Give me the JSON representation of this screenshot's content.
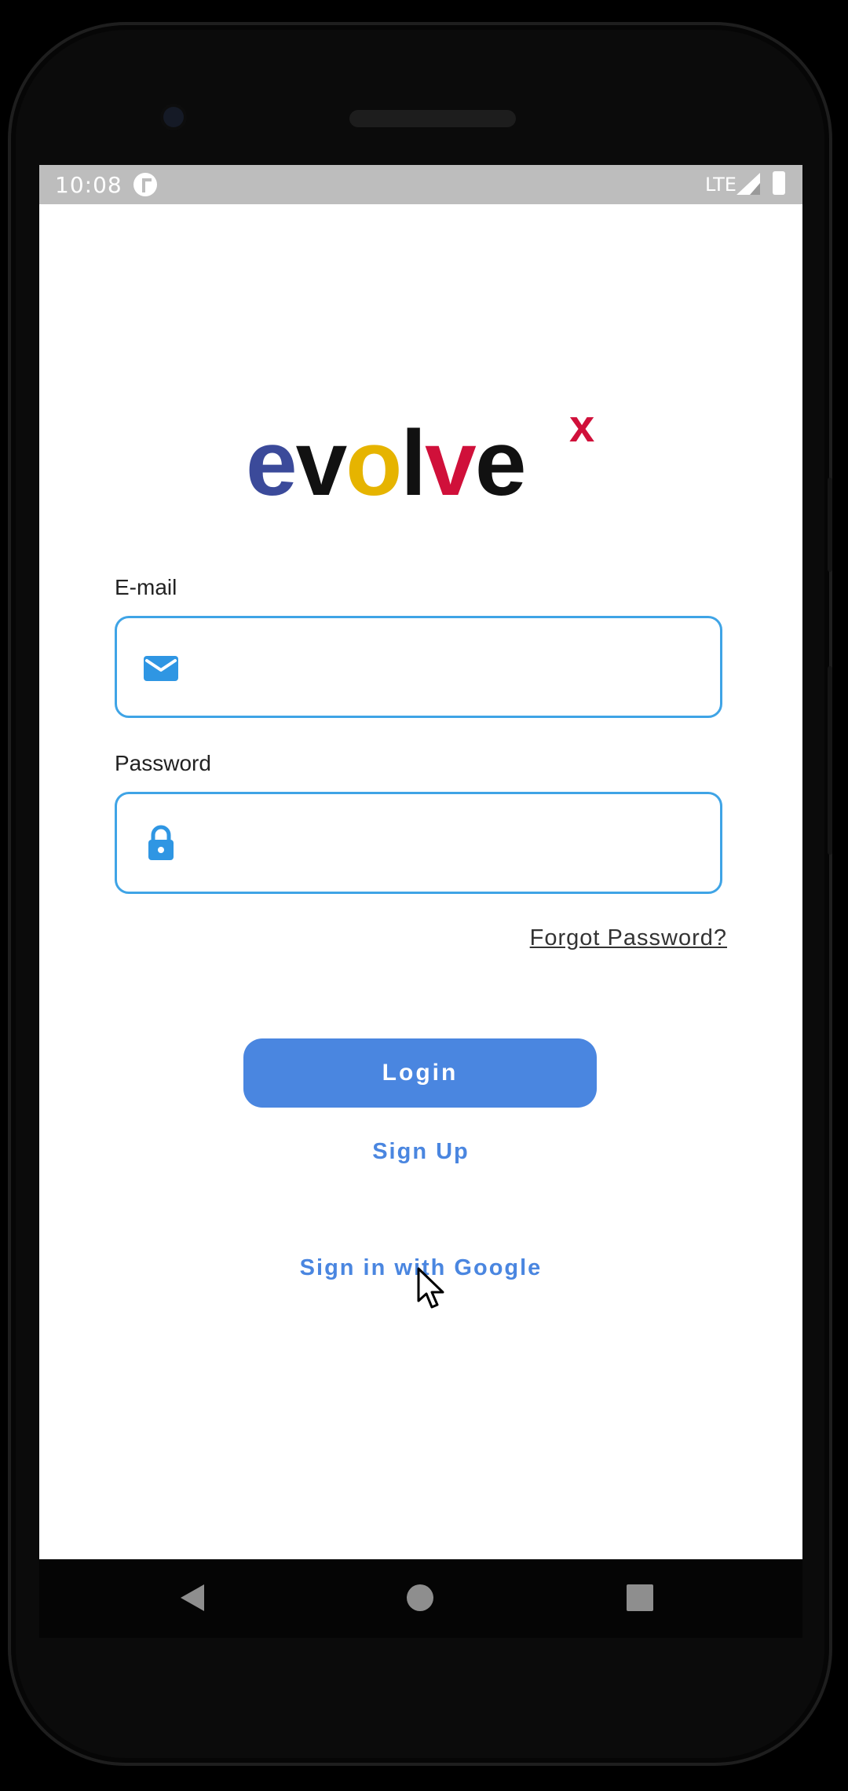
{
  "status_bar": {
    "time": "10:08",
    "network": "LTE",
    "app_icon": "notification-app-icon",
    "signal_icon": "signal-icon",
    "battery_icon": "battery-icon"
  },
  "logo": {
    "text": "evolvex",
    "colors": {
      "e": "#3b4a9a",
      "v": "#111111",
      "o": "#e6b400",
      "l": "#111111",
      "v2": "#d0103a",
      "e2": "#111111",
      "x": "#d0103a"
    }
  },
  "form": {
    "email_label": "E-mail",
    "email_value": "",
    "email_placeholder": "",
    "email_icon": "mail-icon",
    "password_label": "Password",
    "password_value": "",
    "password_placeholder": "",
    "password_icon": "lock-icon",
    "forgot_password": "Forgot Password?"
  },
  "actions": {
    "login_label": "Login",
    "signup_label": "Sign Up",
    "google_label": "Sign in with Google"
  },
  "nav_bar": {
    "back_icon": "back-triangle-icon",
    "home_icon": "home-circle-icon",
    "recents_icon": "recents-square-icon"
  },
  "colors": {
    "accent": "#4a86e0",
    "input_border": "#3fa4e6",
    "status_bar_bg": "#bdbdbd",
    "screen_bg": "#ffffff"
  }
}
